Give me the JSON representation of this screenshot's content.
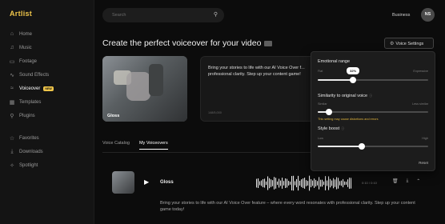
{
  "app": {
    "logo": "Artlist"
  },
  "sidebar": {
    "items": [
      {
        "label": "Home",
        "icon": "home-icon",
        "glyph": "⌂"
      },
      {
        "label": "Music",
        "icon": "music-icon",
        "glyph": "♫"
      },
      {
        "label": "Footage",
        "icon": "footage-icon",
        "glyph": "▭"
      },
      {
        "label": "Sound Effects",
        "icon": "sound-effects-icon",
        "glyph": "∿"
      },
      {
        "label": "Voiceover",
        "icon": "voiceover-icon",
        "glyph": "≈",
        "badge": "NEW"
      },
      {
        "label": "Templates",
        "icon": "templates-icon",
        "glyph": "▦"
      },
      {
        "label": "Plugins",
        "icon": "plugins-icon",
        "glyph": "⚲"
      }
    ],
    "secondary": [
      {
        "label": "Favorites",
        "icon": "star-icon",
        "glyph": "☆"
      },
      {
        "label": "Downloads",
        "icon": "download-icon",
        "glyph": "⤓"
      },
      {
        "label": "Spotlight",
        "icon": "spotlight-icon",
        "glyph": "✧"
      }
    ]
  },
  "topbar": {
    "search_placeholder": "Search",
    "business_label": "Business",
    "avatar_initials": "NS"
  },
  "main": {
    "headline": "Create the perfect voiceover for your video",
    "voice_settings_label": "Voice Settings",
    "preview": {
      "caption": "Gloss",
      "text": "Bring your stories to life with our AI Voice Over f... professional clarity. Step up your content game!",
      "char_count": "148/5,000"
    },
    "tabs": [
      {
        "label": "Voice Catalog",
        "active": false
      },
      {
        "label": "My Voiceovers",
        "active": true
      }
    ],
    "voice_row": {
      "name": "Gloss",
      "duration": "0:10 / 0:10",
      "description": "Bring your stories to life with our AI Voice Over feature – where every word resonates with professional clarity. Step up your content game today!"
    }
  },
  "voice_settings_panel": {
    "emotional_range": {
      "title": "Emotional range",
      "min_label": "Flat",
      "max_label": "Expressive",
      "value_label": "32%",
      "value": 0.32
    },
    "similarity": {
      "title": "Similarity to original voice",
      "min_label": "Similar",
      "max_label": "Less similar",
      "value": 0.1,
      "warning": "This setting may cause distortions and errors"
    },
    "style_boost": {
      "title": "Style boost",
      "min_label": "Low",
      "max_label": "High",
      "value": 0.4
    },
    "reset_label": "Reset"
  },
  "colors": {
    "accent": "#f0c64a",
    "background": "#0c0c0c",
    "panel": "#1c1c1c"
  }
}
